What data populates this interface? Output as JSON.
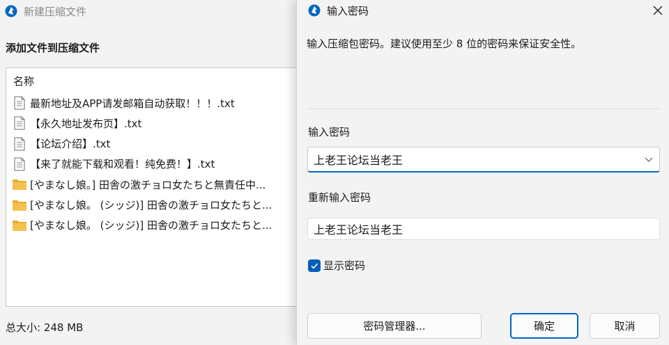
{
  "background_window": {
    "title": "新建压缩文件",
    "subtitle": "添加文件到压缩文件",
    "list_header": "名称",
    "files": [
      {
        "type": "file",
        "name": "最新地址及APP请发邮箱自动获取！！！.txt"
      },
      {
        "type": "file",
        "name": "【永久地址发布页】.txt"
      },
      {
        "type": "file",
        "name": "【论坛介绍】.txt"
      },
      {
        "type": "file",
        "name": "【来了就能下载和观看！纯免费！】.txt"
      },
      {
        "type": "folder",
        "name": "[やまなし娘。] 田舎の激チョロ女たちと無責任中..."
      },
      {
        "type": "folder",
        "name": "[やまなし娘。 (シッジ)] 田舎の激チョロ女たちと..."
      },
      {
        "type": "folder",
        "name": "[やまなし娘。 (シッジ)] 田舎の激チョロ女たちと..."
      }
    ],
    "total_size": "总大小: 248 MB"
  },
  "dialog": {
    "title": "输入密码",
    "description": "输入压缩包密码。建议使用至少 8 位的密码来保证安全性。",
    "password_label": "输入密码",
    "password_value": "上老王论坛当老王",
    "confirm_label": "重新输入密码",
    "confirm_value": "上老王论坛当老王",
    "show_password_label": "显示密码",
    "show_password_checked": true,
    "password_manager_button": "密码管理器...",
    "ok_button": "确定",
    "cancel_button": "取消"
  },
  "colors": {
    "accent": "#0067c0",
    "checkbox": "#005fb8",
    "folder": "#f2c14e",
    "window_bg": "#f3f3f3"
  },
  "icons": {
    "app": "app-logo-icon",
    "file": "text-file-icon",
    "folder": "folder-icon",
    "close": "close-icon",
    "dropdown": "chevron-down-icon",
    "check": "checkmark-icon"
  }
}
